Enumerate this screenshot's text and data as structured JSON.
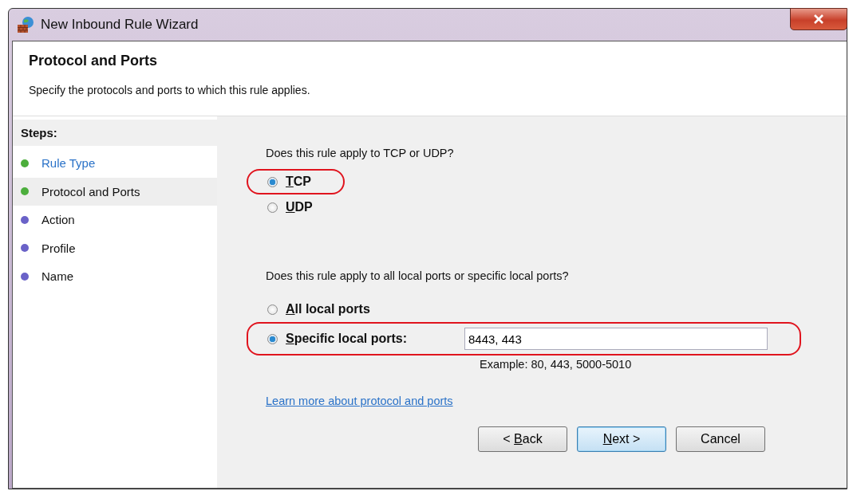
{
  "window": {
    "title": "New Inbound Rule Wizard"
  },
  "header": {
    "title": "Protocol and Ports",
    "subtitle": "Specify the protocols and ports to which this rule applies."
  },
  "steps": {
    "heading": "Steps:",
    "items": [
      {
        "label": "Rule Type",
        "color": "#4cae3c",
        "selected": false,
        "link": true
      },
      {
        "label": "Protocol and Ports",
        "color": "#4cae3c",
        "selected": true,
        "link": false
      },
      {
        "label": "Action",
        "color": "#6a62c8",
        "selected": false,
        "link": false
      },
      {
        "label": "Profile",
        "color": "#6a62c8",
        "selected": false,
        "link": false
      },
      {
        "label": "Name",
        "color": "#6a62c8",
        "selected": false,
        "link": false
      }
    ]
  },
  "protocol": {
    "question": "Does this rule apply to TCP or UDP?",
    "options": [
      {
        "label_parts": {
          "key": "T",
          "rest": "CP"
        },
        "selected": true,
        "highlighted": true
      },
      {
        "label_parts": {
          "key": "U",
          "rest": "DP"
        },
        "selected": false,
        "highlighted": false
      }
    ]
  },
  "ports": {
    "question": "Does this rule apply to all local ports or specific local ports?",
    "options": [
      {
        "label_parts": {
          "key": "A",
          "rest": "ll local ports"
        },
        "selected": false,
        "highlighted": false
      },
      {
        "label_parts": {
          "key": "S",
          "rest": "pecific local ports:"
        },
        "selected": true,
        "highlighted": true,
        "value": "8443, 443",
        "example": "Example: 80, 443, 5000-5010"
      }
    ]
  },
  "link": "Learn more about protocol and ports",
  "buttons": [
    {
      "label_parts": {
        "before": "< ",
        "key": "B",
        "rest": "ack"
      },
      "default": false
    },
    {
      "label_parts": {
        "key": "N",
        "rest": "ext >"
      },
      "default": true
    },
    {
      "label_parts": {
        "before": "Cancel"
      },
      "default": false
    }
  ]
}
